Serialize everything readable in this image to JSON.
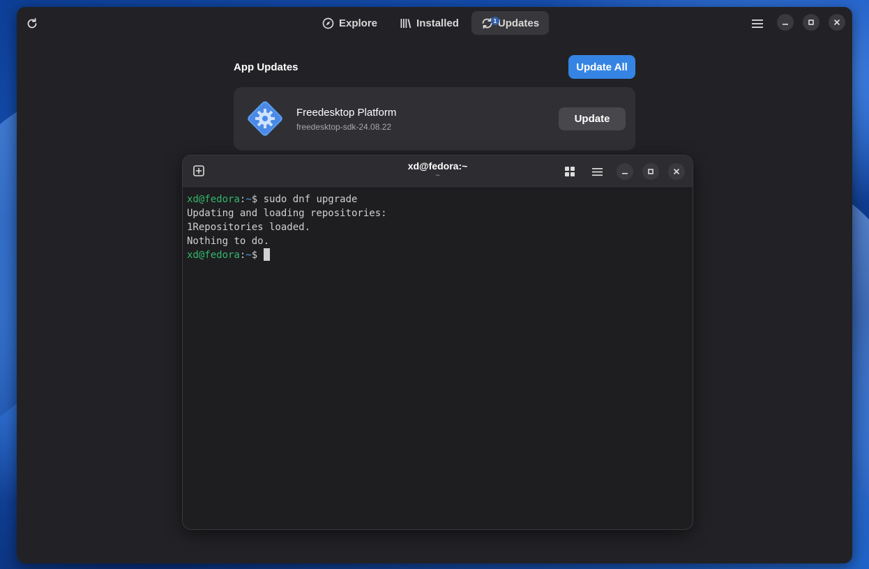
{
  "software": {
    "tabs": [
      {
        "label": "Explore",
        "icon": "compass-icon"
      },
      {
        "label": "Installed",
        "icon": "library-icon"
      },
      {
        "label": "Updates",
        "icon": "refresh-icon",
        "badge": "1",
        "active": true
      }
    ],
    "section_title": "App Updates",
    "update_all_label": "Update All",
    "app": {
      "name": "Freedesktop Platform",
      "version": "freedesktop-sdk-24.08.22",
      "button_label": "Update"
    }
  },
  "terminal": {
    "title": "xd@fedora:~",
    "subtitle": "~",
    "lines": [
      {
        "user": "xd@fedora",
        "sep": ":",
        "path": "~",
        "rest": "$ sudo dnf upgrade"
      },
      {
        "text": "Updating and loading repositories:"
      },
      {
        "text": "1Repositories loaded."
      },
      {
        "text": "Nothing to do."
      },
      {
        "user": "xd@fedora",
        "sep": ":",
        "path": "~",
        "rest": "$ "
      }
    ]
  },
  "colors": {
    "accent": "#3584e4",
    "prompt_user": "#33b86a",
    "prompt_path": "#4d9be8"
  }
}
